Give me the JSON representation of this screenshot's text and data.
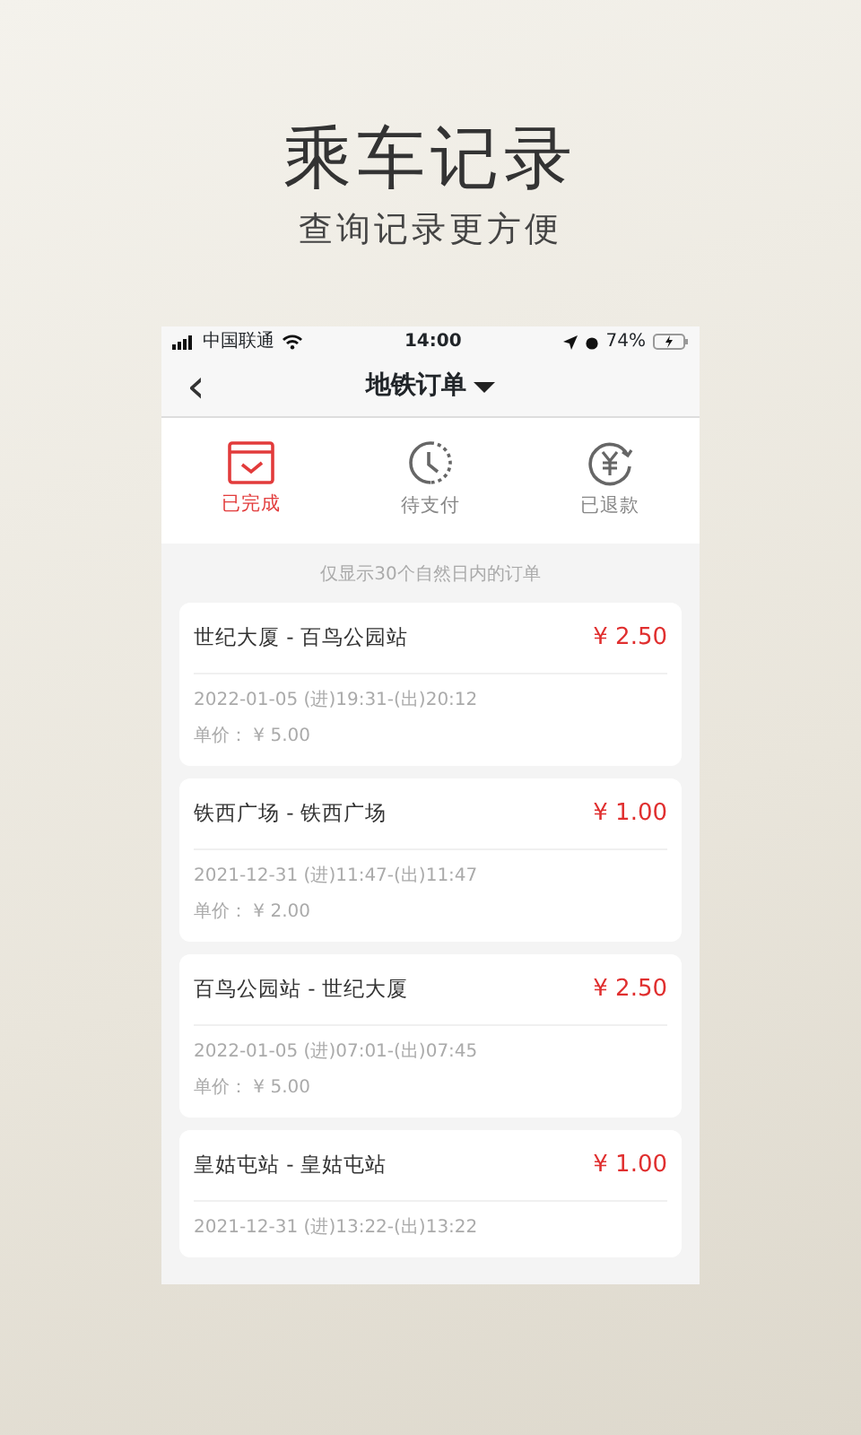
{
  "headline": {
    "title": "乘车记录",
    "subtitle": "查询记录更方便"
  },
  "status_bar": {
    "carrier": "中国联通",
    "time": "14:00",
    "battery": "74%"
  },
  "nav": {
    "back": "‹",
    "title": "地铁订单"
  },
  "tabs": [
    {
      "label": "已完成",
      "selected": true,
      "kind": "calendar"
    },
    {
      "label": "待支付",
      "selected": false,
      "kind": "clock"
    },
    {
      "label": "已退款",
      "selected": false,
      "kind": "refund"
    }
  ],
  "notice": "仅显示30个自然日内的订单",
  "orders": [
    {
      "route": "世纪大厦 - 百鸟公园站",
      "amount": "¥ 2.50",
      "times": "2022-01-05 (进)19:31-(出)20:12",
      "unit_price": "单价： ¥ 5.00"
    },
    {
      "route": "铁西广场 - 铁西广场",
      "amount": "¥ 1.00",
      "times": "2021-12-31 (进)11:47-(出)11:47",
      "unit_price": "单价： ¥ 2.00"
    },
    {
      "route": "百鸟公园站 - 世纪大厦",
      "amount": "¥ 2.50",
      "times": "2022-01-05 (进)07:01-(出)07:45",
      "unit_price": "单价： ¥ 5.00"
    },
    {
      "route": "皇姑屯站 - 皇姑屯站",
      "amount": "¥ 1.00",
      "times": "2021-12-31 (进)13:22-(出)13:22"
    }
  ]
}
